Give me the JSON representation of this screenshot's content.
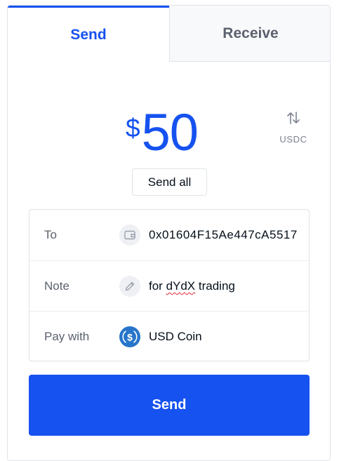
{
  "tabs": {
    "send_label": "Send",
    "receive_label": "Receive"
  },
  "amount": {
    "currency_symbol": "$",
    "value": "50"
  },
  "currency_toggle": {
    "icon": "swap-vertical-arrows-icon",
    "currency": "USDC"
  },
  "send_all_label": "Send all",
  "details": {
    "to": {
      "label": "To",
      "icon": "wallet-icon",
      "value": "0x01604F15Ae447cA5517"
    },
    "note": {
      "label": "Note",
      "icon": "pencil-icon",
      "value_prefix": "for ",
      "value_misspelled": "dYdX",
      "value_suffix": " trading"
    },
    "pay_with": {
      "label": "Pay with",
      "icon": "usd-coin-icon",
      "value": "USD Coin"
    }
  },
  "send_button_label": "Send",
  "colors": {
    "accent": "#1652f0",
    "muted_text": "#5b616e",
    "border": "#dfe3e8",
    "usdc_blue": "#2775ca",
    "spellcheck_red": "#e2263b"
  }
}
